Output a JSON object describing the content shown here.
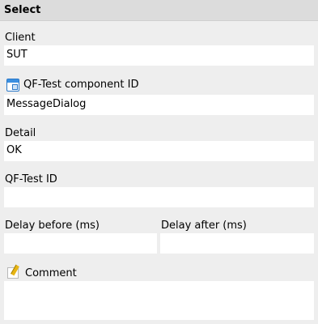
{
  "header": {
    "title": "Select"
  },
  "client": {
    "label": "Client",
    "value": "SUT"
  },
  "component_id": {
    "label": "QF-Test component ID",
    "value": "MessageDialog",
    "icon": "component-id-icon"
  },
  "detail": {
    "label": "Detail",
    "value": "OK"
  },
  "qftest_id": {
    "label": "QF-Test ID",
    "value": ""
  },
  "delay_before": {
    "label": "Delay before (ms)",
    "value": ""
  },
  "delay_after": {
    "label": "Delay after (ms)",
    "value": ""
  },
  "comment": {
    "label": "Comment",
    "value": "",
    "icon": "comment-pencil-icon"
  }
}
